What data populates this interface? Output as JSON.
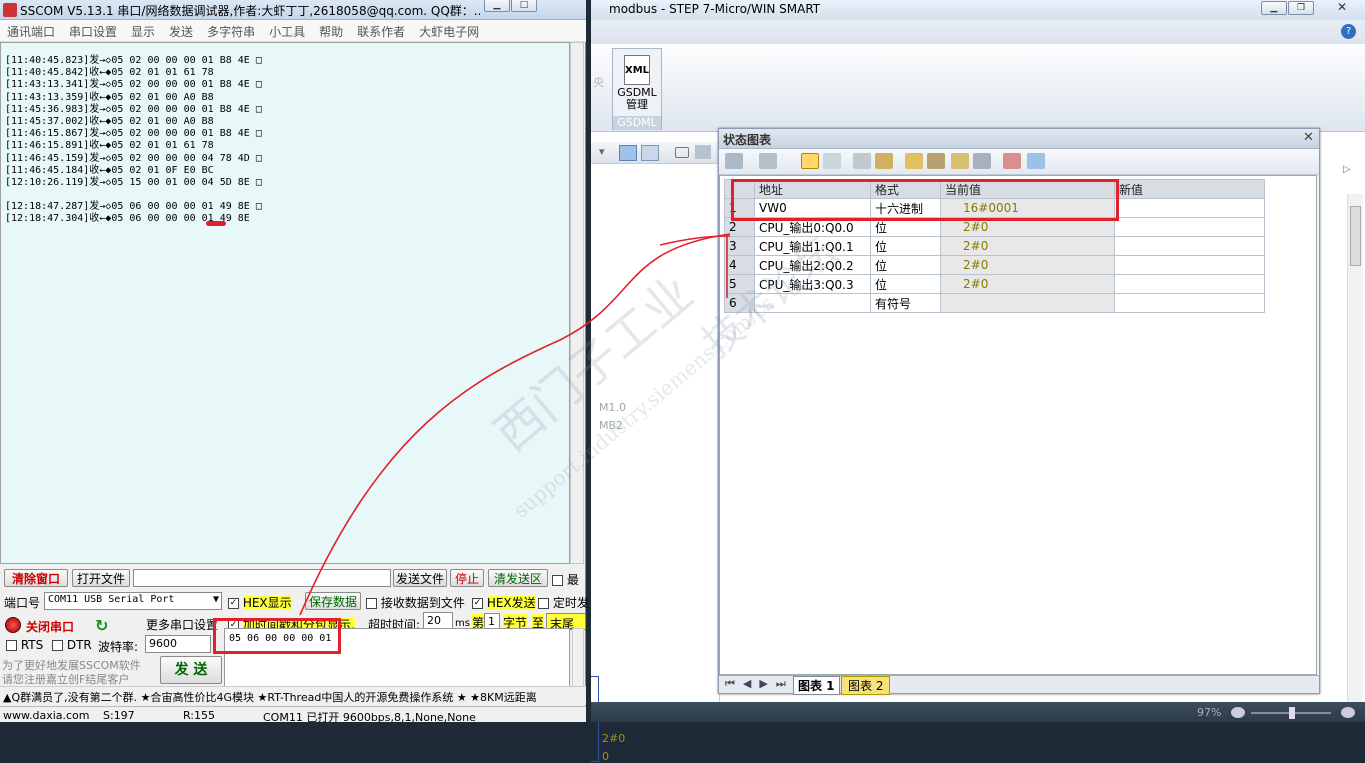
{
  "sscom": {
    "title": "SSCOM V5.13.1 串口/网络数据调试器,作者:大虾丁丁,2618058@qq.com. QQ群：...",
    "menu": [
      "通讯端口",
      "串口设置",
      "显示",
      "发送",
      "多字符串",
      "小工具",
      "帮助",
      "联系作者",
      "大虾电子网"
    ],
    "log_lines": [
      "[11:40:45.823]发→◇05 02 00 00 00 01 B8 4E □",
      "[11:40:45.842]收←◆05 02 01 01 61 78",
      "[11:43:13.341]发→◇05 02 00 00 00 01 B8 4E □",
      "[11:43:13.359]收←◆05 02 01 00 A0 B8",
      "[11:45:36.983]发→◇05 02 00 00 00 01 B8 4E □",
      "[11:45:37.002]收←◆05 02 01 00 A0 B8",
      "[11:46:15.867]发→◇05 02 00 00 00 01 B8 4E □",
      "[11:46:15.891]收←◆05 02 01 01 61 78",
      "[11:46:45.159]发→◇05 02 00 00 00 04 78 4D □",
      "[11:46:45.184]收←◆05 02 01 0F E0 BC",
      "[12:10:26.119]发→◇05 15 00 01 00 04 5D 8E □",
      "",
      "[12:18:47.287]发→◇05 06 00 00 00 01 49 8E □",
      "[12:18:47.304]收←◆05 06 00 00 00 01 49 8E"
    ],
    "clear_window": "清除窗口",
    "open_file": "打开文件",
    "send_file": "发送文件",
    "stop": "停止",
    "clear_send": "清发送区",
    "last_label": "最",
    "port_label": "端口号",
    "port_value": "COM11 USB Serial Port",
    "hex_display": "HEX显示",
    "save_data": "保存数据",
    "recv_to_file": "接收数据到文件",
    "hex_send": "HEX发送",
    "timed_send": "定时发",
    "close_port": "关闭串口",
    "more_settings": "更多串口设置",
    "add_timestamp": "加时间戳和分包显示,",
    "timeout_label": "超时时间:",
    "timeout_value": "20",
    "timeout_unit": "ms",
    "byte_prefix": "第",
    "byte_index": "1",
    "byte_unit": "字节",
    "byte_to": "至",
    "byte_end": "末尾",
    "rts": "RTS",
    "dtr": "DTR",
    "baud_label": "波特率:",
    "baud_value": "9600",
    "send_input": "05 06 00 00 00 01",
    "promo_line1": "为了更好地发展SSCOM软件",
    "promo_line2": "请您注册嘉立创F结尾客户",
    "send_button": "发 送",
    "ticker": "▲Q群满员了,没有第二个群. ★合宙高性价比4G模块 ★RT-Thread中国人的开源免费操作系统 ★ ★8KM远距离",
    "status_url": "www.daxia.com",
    "status_s": "S:197",
    "status_r": "R:155",
    "status_port": "COM11 已打开  9600bps,8,1,None,None"
  },
  "step7": {
    "title": "modbus - STEP 7-Micro/WIN SMART",
    "ribbon_faded": "央",
    "gsdml_icon_text": "XML",
    "gsdml_label": "GSDML\n管理",
    "gsdml_group": "GSDML",
    "bg_labels": [
      "M1.0",
      "MB2",
      "2#0",
      "0"
    ],
    "zoom": "97%",
    "panel": {
      "title": "状态图表",
      "columns": [
        "地址",
        "格式",
        "当前值",
        "新值"
      ],
      "rows": [
        {
          "n": "1",
          "addr": "VW0",
          "fmt": "十六进制",
          "val": "16#0001",
          "new": ""
        },
        {
          "n": "2",
          "addr": "CPU_输出0:Q0.0",
          "fmt": "位",
          "val": "2#0",
          "new": ""
        },
        {
          "n": "3",
          "addr": "CPU_输出1:Q0.1",
          "fmt": "位",
          "val": "2#0",
          "new": ""
        },
        {
          "n": "4",
          "addr": "CPU_输出2:Q0.2",
          "fmt": "位",
          "val": "2#0",
          "new": ""
        },
        {
          "n": "5",
          "addr": "CPU_输出3:Q0.3",
          "fmt": "位",
          "val": "2#0",
          "new": ""
        },
        {
          "n": "6",
          "addr": "",
          "fmt": "有符号",
          "val": "",
          "new": ""
        }
      ],
      "tabs": [
        "图表 1",
        "图表 2"
      ]
    },
    "watermark1": "西门子工业",
    "watermark2": "support.industry.siemens.com/cs",
    "watermark3": "技术论坛"
  },
  "colors": {
    "annotation_red": "#e0202a",
    "highlight_yellow": "#ffff3a"
  }
}
